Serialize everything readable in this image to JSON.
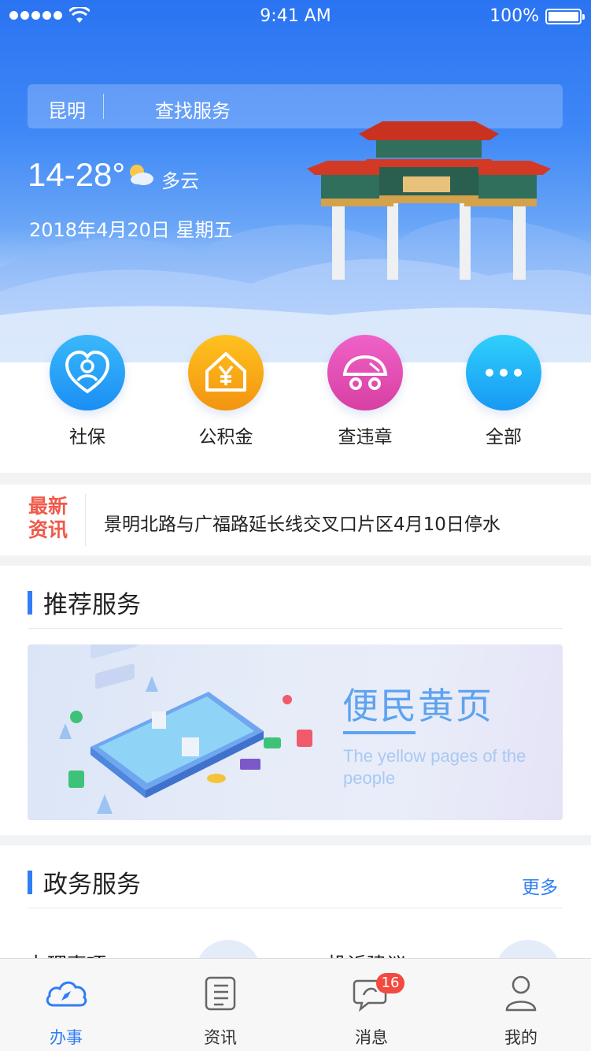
{
  "status_bar": {
    "time": "9:41 AM",
    "battery": "100%"
  },
  "search": {
    "city": "昆明",
    "placeholder": "查找服务"
  },
  "weather": {
    "temperature": "14-28°",
    "condition": "多云",
    "icon": "partly-cloudy-icon",
    "date": "2018年4月20日 星期五"
  },
  "quick_services": [
    {
      "label": "社保",
      "icon": "social-security-icon",
      "color": "#1c9cf6"
    },
    {
      "label": "公积金",
      "icon": "housing-fund-icon",
      "color": "#f7a411"
    },
    {
      "label": "查违章",
      "icon": "traffic-violation-icon",
      "color": "#e34fb3"
    },
    {
      "label": "全部",
      "icon": "more-icon",
      "color": "#1c9cf6"
    }
  ],
  "news": {
    "tag_line1": "最新",
    "tag_line2": "资讯",
    "headline": "景明北路与广福路延长线交叉口片区4月10日停水"
  },
  "recommended": {
    "title": "推荐服务",
    "banner_title": "便民黄页",
    "banner_subtitle": "The yellow pages of the people"
  },
  "gov_services": {
    "title": "政务服务",
    "more": "更多",
    "items": [
      "办理事项",
      "投诉建议"
    ]
  },
  "tabs": [
    {
      "label": "办事",
      "icon": "compass-cloud-icon",
      "active": true
    },
    {
      "label": "资讯",
      "icon": "news-list-icon",
      "active": false
    },
    {
      "label": "消息",
      "icon": "message-icon",
      "active": false,
      "badge": "16"
    },
    {
      "label": "我的",
      "icon": "profile-icon",
      "active": false
    }
  ],
  "colors": {
    "primary": "#2f7ef5",
    "news_tag": "#f05a4a"
  }
}
